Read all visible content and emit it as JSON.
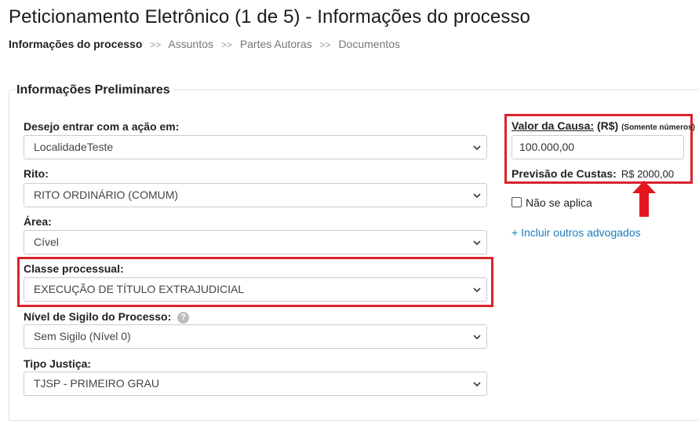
{
  "page": {
    "title": "Peticionamento Eletrônico (1 de 5) - Informações do processo"
  },
  "breadcrumb": {
    "items": [
      "Informações do processo",
      "Assuntos",
      "Partes Autoras",
      "Documentos"
    ],
    "separator": ">>"
  },
  "panel": {
    "title": "Informações Preliminares"
  },
  "fields": {
    "localidade": {
      "label": "Desejo entrar com a ação em:",
      "value": "LocalidadeTeste"
    },
    "rito": {
      "label": "Rito:",
      "value": "RITO ORDINÁRIO (COMUM)"
    },
    "area": {
      "label": "Área:",
      "value": "Cível"
    },
    "classe": {
      "label": "Classe processual:",
      "value": "EXECUÇÃO DE TÍTULO EXTRAJUDICIAL"
    },
    "sigilo": {
      "label": "Nível de Sigilo do Processo:",
      "value": "Sem Sigilo (Nível 0)",
      "help": "?"
    },
    "tipo_justica": {
      "label": "Tipo Justiça:",
      "value": "TJSP - PRIMEIRO GRAU"
    }
  },
  "valor_causa": {
    "label": "Valor da Causa:",
    "currency": "(R$)",
    "hint": "(Somente números)",
    "value": "100.000,00"
  },
  "custas": {
    "label": "Previsão de Custas:",
    "value": "R$ 2000,00"
  },
  "nao_se_aplica": {
    "label": "Não se aplica",
    "checked": false
  },
  "add_advogados": {
    "label": "+ Incluir outros advogados"
  },
  "colors": {
    "highlight": "#d9232d",
    "link": "#1a7bbf",
    "border": "#cccccc"
  }
}
